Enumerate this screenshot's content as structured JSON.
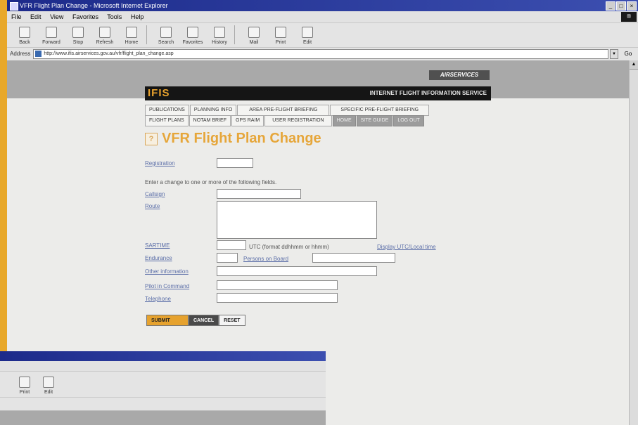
{
  "window": {
    "title": "VFR Flight Plan Change - Microsoft Internet Explorer",
    "controls": [
      "_",
      "□",
      "×"
    ]
  },
  "menu": [
    "File",
    "Edit",
    "View",
    "Favorites",
    "Tools",
    "Help"
  ],
  "toolbar": [
    "Back",
    "Forward",
    "Stop",
    "Refresh",
    "Home",
    "Search",
    "Favorites",
    "History",
    "Mail",
    "Print",
    "Edit"
  ],
  "address": {
    "label": "Address",
    "url": "http://www.ifis.airservices.gov.au/vfr/flight_plan_change.asp",
    "go": "Go"
  },
  "site": {
    "brand": "AIRSERVICES",
    "logo": "IFIS",
    "tagline": "INTERNET FLIGHT INFORMATION SERVICE"
  },
  "nav_top": [
    "PUBLICATIONS",
    "PLANNING INFO",
    "AREA PRE-FLIGHT BRIEFING",
    "SPECIFIC PRE-FLIGHT BRIEFING"
  ],
  "nav_bottom": [
    "FLIGHT PLANS",
    "NOTAM BRIEF",
    "GPS RAIM",
    "USER REGISTRATION",
    "HOME",
    "SITE GUIDE",
    "LOG OUT"
  ],
  "page": {
    "title": "VFR Flight Plan Change",
    "help": "?"
  },
  "form": {
    "registration_label": "Registration",
    "instructions": "Enter a change to one or more of the following fields.",
    "callsign_label": "Callsign",
    "route_label": "Route",
    "sartime_label": "SARTIME",
    "sartime_hint": "UTC (format ddhhmm or hhmm)",
    "display_utc": "Display UTC/Local time",
    "endurance_label": "Endurance",
    "persons_label": "Persons on Board",
    "other_label": "Other information",
    "pic_label": "Pilot in Command",
    "phone_label": "Telephone",
    "submit": "SUBMIT",
    "cancel": "CANCEL",
    "reset": "RESET"
  }
}
